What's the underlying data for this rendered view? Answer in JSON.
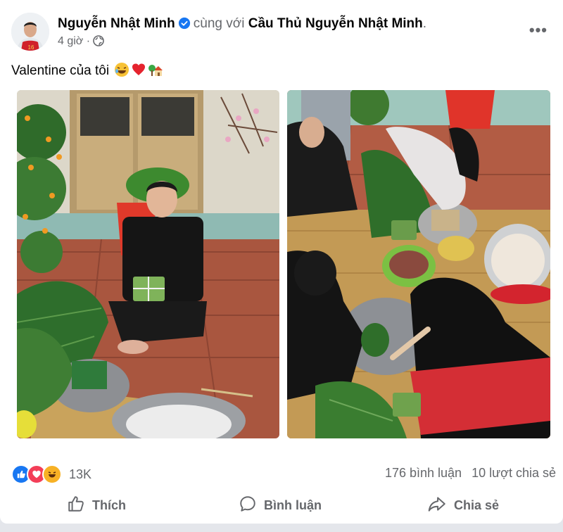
{
  "post": {
    "author": "Nguyễn Nhật Minh",
    "with_text": "cùng với",
    "tagged": "Cầu Thủ Nguyễn Nhật Minh",
    "time": "4 giờ",
    "caption": "Valentine của tôi",
    "more_label": "•••",
    "reaction_count": "13K",
    "comments": "176 bình luận",
    "shares": "10 lượt chia sẻ"
  },
  "actions": {
    "like": "Thích",
    "comment": "Bình luận",
    "share": "Chia sẻ"
  },
  "icons": {
    "verified": "verified-badge-icon",
    "privacy": "globe-icon",
    "caption_emojis": [
      "laughing-face-emoji",
      "red-heart-emoji",
      "house-with-tree-emoji"
    ],
    "reactions": [
      "like-icon",
      "love-icon",
      "haha-icon"
    ]
  },
  "colors": {
    "brand_blue": "#1877f2",
    "love_red": "#f33e58",
    "haha_yellow": "#f7b125",
    "muted_text": "#65676b"
  }
}
